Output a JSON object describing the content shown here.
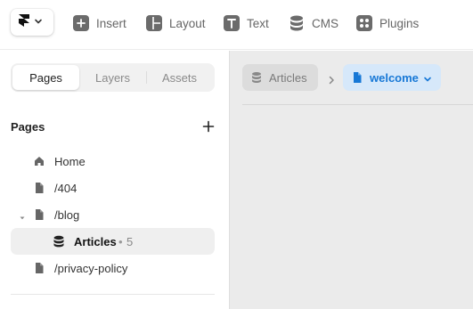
{
  "colors": {
    "accent": "#1778D6",
    "accent_bg": "#D6E8FA",
    "canvas_bg": "#EBEBEB"
  },
  "toolbar": {
    "logo_icon": "framer-logo-icon",
    "items": [
      {
        "label": "Insert",
        "icon": "plus-square-icon"
      },
      {
        "label": "Layout",
        "icon": "layout-icon"
      },
      {
        "label": "Text",
        "icon": "text-icon"
      },
      {
        "label": "CMS",
        "icon": "database-icon"
      },
      {
        "label": "Plugins",
        "icon": "plugins-icon"
      }
    ]
  },
  "left_panel": {
    "tabs": [
      {
        "label": "Pages",
        "active": true
      },
      {
        "label": "Layers",
        "active": false
      },
      {
        "label": "Assets",
        "active": false
      }
    ],
    "section_title": "Pages",
    "pages": [
      {
        "label": "Home",
        "icon": "home-icon"
      },
      {
        "label": "/404",
        "icon": "page-icon"
      },
      {
        "label": "/blog",
        "icon": "page-icon",
        "expanded": true
      },
      {
        "label": "Articles",
        "count": "5",
        "icon": "database-icon",
        "selected": true
      },
      {
        "label": "/privacy-policy",
        "icon": "page-icon"
      }
    ]
  },
  "canvas": {
    "breadcrumb": [
      {
        "label": "Articles",
        "icon": "database-icon"
      },
      {
        "label": "welcome",
        "icon": "page-icon",
        "active": true
      }
    ]
  }
}
